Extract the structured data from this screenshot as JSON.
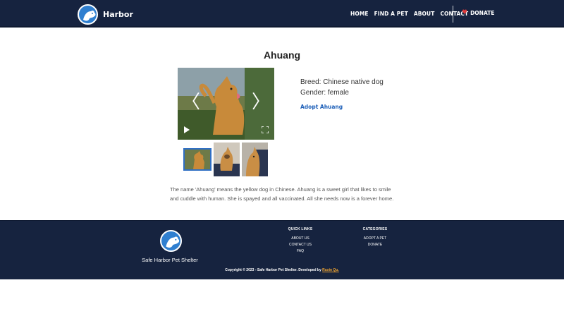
{
  "header": {
    "brand": "Harbor",
    "nav": [
      "HOME",
      "FIND A PET",
      "ABOUT",
      "CONTACT"
    ],
    "donate_label": "DONATE"
  },
  "pet": {
    "name": "Ahuang",
    "breed": "Breed: Chinese native dog",
    "gender": "Gender: female",
    "adopt_link": "Adopt Ahuang",
    "description": "The name 'Ahuang' means the yellow dog in Chinese. Ahuang is a sweet girl that likes to smile and cuddle with human. She is spayed and all vaccinated. All she needs now is a forever home."
  },
  "gallery": {
    "prev_glyph": "〈",
    "next_glyph": "〉",
    "thumbnails": 3,
    "active_index": 0
  },
  "footer": {
    "org_name": "Safe Harbor Pet Shelter",
    "quick_links": {
      "title": "QUICK LINKS",
      "items": [
        "ABOUT US",
        "CONTACT US",
        "FAQ"
      ]
    },
    "categories": {
      "title": "CATEGORIES",
      "items": [
        "ADOPT A PET",
        "DONATE"
      ]
    },
    "copyright": "Copyright © 2023 - Safe Harbor Pet Shelter. Developed by",
    "developer": "Ruxin Qu."
  },
  "colors": {
    "navy": "#16233f",
    "brand_blue": "#2f7fd0",
    "link_blue": "#1d5fb8",
    "heart_red": "#e03b3b",
    "developer_orange": "#f0a531"
  }
}
